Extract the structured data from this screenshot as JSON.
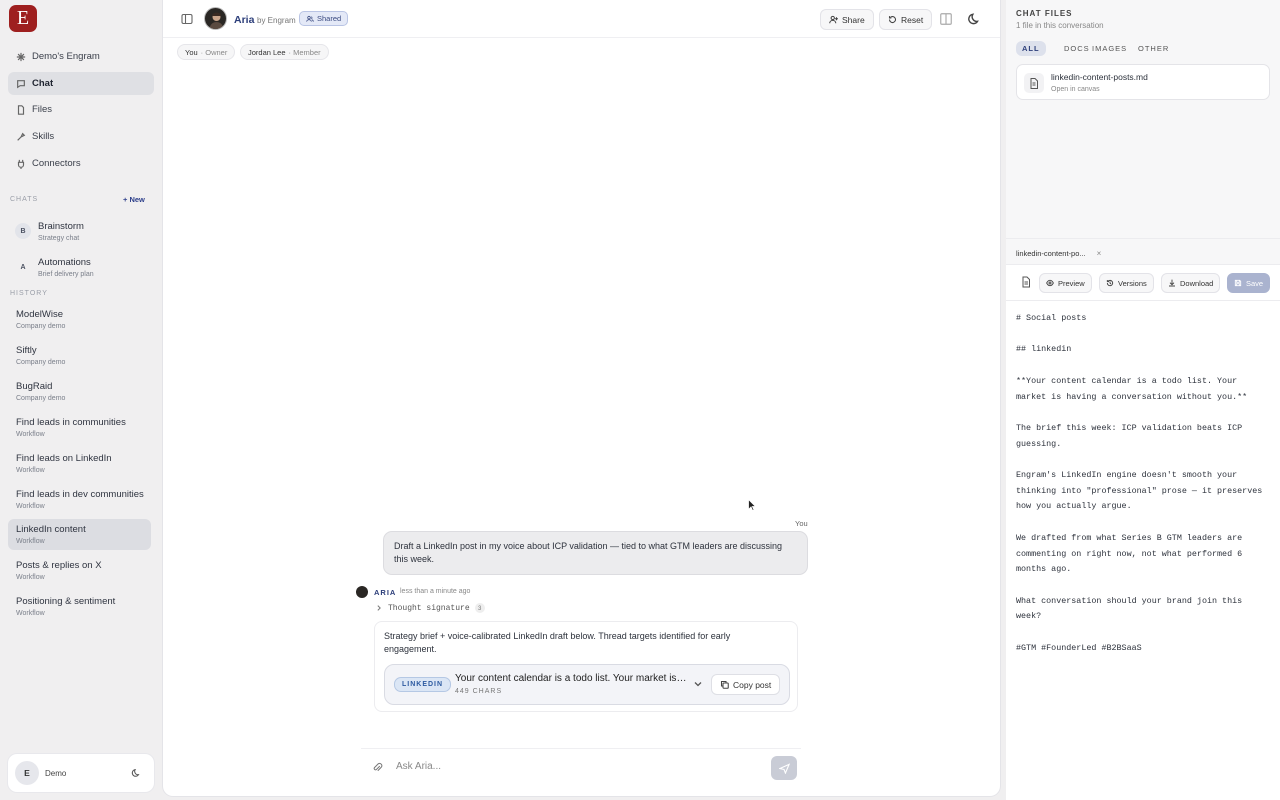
{
  "sidebar": {
    "logo_letter": "E",
    "nav": [
      {
        "label": "Demo's Engram",
        "icon": "sparkle-icon"
      },
      {
        "label": "Chat",
        "icon": "chat-bubble-icon"
      },
      {
        "label": "Files",
        "icon": "file-icon"
      },
      {
        "label": "Skills",
        "icon": "skills-icon"
      },
      {
        "label": "Connectors",
        "icon": "plug-icon"
      }
    ],
    "chats_label": "CHATS",
    "new_label": "+ New",
    "chats": [
      {
        "avatar": "B",
        "title": "Brainstorm",
        "sub": "Strategy chat"
      },
      {
        "avatar": "A",
        "title": "Automations",
        "sub": "Brief delivery plan"
      }
    ],
    "history_label": "HISTORY",
    "history": [
      {
        "title": "ModelWise",
        "sub": "Company demo"
      },
      {
        "title": "Siftly",
        "sub": "Company demo"
      },
      {
        "title": "BugRaid",
        "sub": "Company demo"
      },
      {
        "title": "Find leads in communities",
        "sub": "Workflow"
      },
      {
        "title": "Find leads on LinkedIn",
        "sub": "Workflow"
      },
      {
        "title": "Find leads in dev communities",
        "sub": "Workflow"
      },
      {
        "title": "LinkedIn content",
        "sub": "Workflow"
      },
      {
        "title": "Posts & replies on X",
        "sub": "Workflow"
      },
      {
        "title": "Positioning & sentiment",
        "sub": "Workflow"
      }
    ],
    "user": {
      "avatar": "E",
      "name": "Demo"
    }
  },
  "header": {
    "agent_name": "Aria",
    "agent_by": "by Engram",
    "shared_label": "Shared",
    "share_label": "Share",
    "reset_label": "Reset"
  },
  "members": [
    {
      "name": "You",
      "role": "· Owner"
    },
    {
      "name": "Jordan Lee",
      "role": "· Member"
    }
  ],
  "conversation": {
    "you_label": "You",
    "user_message": "Draft a LinkedIn post in my voice about ICP validation — tied to what GTM leaders are discussing this week.",
    "assistant_label": "ARIA",
    "assistant_time": "less than a minute ago",
    "thought_label": "Thought signature",
    "thought_count": "3",
    "reply_text": "Strategy brief + voice-calibrated LinkedIn draft below. Thread targets identified for early engagement.",
    "post": {
      "badge": "LINKEDIN",
      "title": "Your content calendar is a todo list. Your market is having a conversation without you.",
      "chars": "449 CHARS",
      "copy_label": "Copy post"
    }
  },
  "composer": {
    "placeholder": "Ask Aria..."
  },
  "files_panel": {
    "title": "CHAT FILES",
    "subtitle": "1 file in this conversation",
    "filters": [
      "ALL",
      "DOCS",
      "IMAGES",
      "OTHER"
    ],
    "file": {
      "name": "linkedin-content-posts.md",
      "sub": "Open in canvas"
    }
  },
  "editor": {
    "tab_label": "linkedin-content-po...",
    "close_label": "×",
    "preview_label": "Preview",
    "versions_label": "Versions",
    "download_label": "Download",
    "save_label": "Save",
    "content": "# Social posts\n\n## linkedin\n\n**Your content calendar is a todo list. Your market is having a conversation without you.**\n\nThe brief this week: ICP validation beats ICP guessing.\n\nEngram's LinkedIn engine doesn't smooth your thinking into \"professional\" prose — it preserves how you actually argue.\n\nWe drafted from what Series B GTM leaders are commenting on right now, not what performed 6 months ago.\n\nWhat conversation should your brand join this week?\n\n#GTM #FounderLed #B2BSaaS"
  },
  "colors": {
    "brand": "#9e1f1f",
    "accent": "#2c3e7a",
    "linkedin": "#2c5aa0"
  }
}
